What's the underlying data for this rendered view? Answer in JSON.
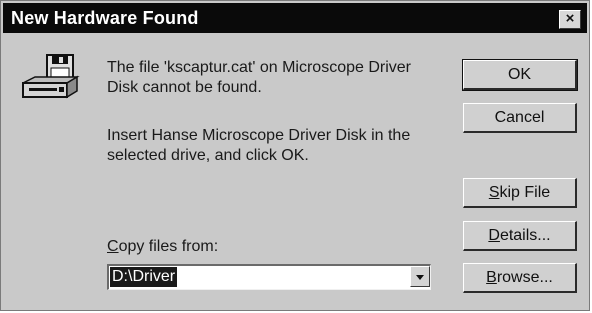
{
  "window": {
    "title": "New Hardware Found",
    "close_label": "×"
  },
  "message": {
    "line1": "The file 'kscaptur.cat' on Microscope Driver Disk cannot be found.",
    "line2": "Insert Hanse Microscope Driver Disk in the selected drive, and click OK."
  },
  "copy_from": {
    "label_first": "C",
    "label_rest": "opy files from:",
    "value": "D:\\Driver"
  },
  "buttons": {
    "ok": "OK",
    "cancel": "Cancel",
    "skip_first": "S",
    "skip_rest": "kip File",
    "details_first": "D",
    "details_rest": "etails...",
    "browse_first": "B",
    "browse_rest": "rowse..."
  },
  "icons": {
    "drive": "disk-drive-icon"
  }
}
